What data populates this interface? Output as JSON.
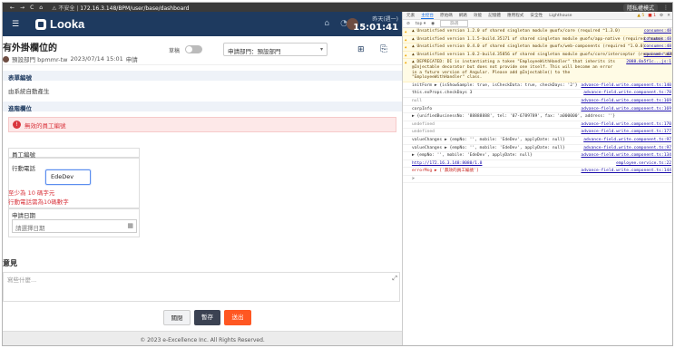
{
  "browser": {
    "nav": [
      "←",
      "→",
      "C",
      "⌂"
    ],
    "insecure_label": "⚠ 不安全",
    "address": "172.16.3.148/BPM/user/base/dashboard",
    "pill": "隱私權模式",
    "menu": "⋮"
  },
  "app": {
    "logo_text": "Looka",
    "date": "昨天(週一)",
    "time": "15:01:41",
    "form_title": "有外掛欄位的",
    "applicant": "預設部門 bpmmr-tw",
    "datetime": "2023/07/14 15:01",
    "status": "申請",
    "draft_label": "草稿",
    "dept_select": "申請部門：預設部門",
    "section_form": "表單編號",
    "auto_number": "由系統自動產生",
    "section_plugin": "進階欄位",
    "alert_text": "無效的員工編號",
    "fields": {
      "employee_id_label": "員工編號",
      "mobile_label": "行動電話",
      "mobile_value": "EdeDev",
      "err_min": "至少為 10 碼字元",
      "err_digits": "行動電話需為10碼數字",
      "apply_date_label": "申請日期",
      "apply_date_placeholder": "請選擇日期"
    },
    "opinion_label": "意見",
    "comment_placeholder": "寫些什麼...",
    "buttons": {
      "close": "關閉",
      "save": "暫存",
      "submit": "送出"
    },
    "footer": "© 2023 e-Excellence Inc. All Rights Reserved."
  },
  "devtools": {
    "tabs": [
      "元素",
      "主控台",
      "原始碼",
      "網路",
      "效能",
      "記憶體",
      "應用程式",
      "安全性",
      "Lighthouse"
    ],
    "active_tab": "主控台",
    "badge_warn": "▲ 5",
    "badge_err": "■ 1",
    "toolbar": {
      "context": "top ▾",
      "filter": "篩選"
    },
    "rows": [
      {
        "kind": "warn",
        "text": "▲ Unsatisfied version 1.2.0 of shared singleton module @uofx/core (required ^1.3.0)",
        "src": "consumes:48"
      },
      {
        "kind": "warn",
        "text": "▲ Unsatisfied version 1.1.5-build.35171 of shared singleton module @uofx/app-native (required ^auto)",
        "src": "consumes:48"
      },
      {
        "kind": "warn",
        "text": "▲ Unsatisfied version 0.4.0 of shared singleton module @uofx/web-components (required ^1.0.0)",
        "src": "consumes:48"
      },
      {
        "kind": "warn",
        "text": "▲ Unsatisfied version 1.0.2-build.35856 of shared singleton module @uofx/core/interceptor (required ^auto)",
        "src": "consumes:48"
      },
      {
        "kind": "warn",
        "text": "▲ DEPRECATED: DI is instantiating a token \"EmployeeWithHandler\" that inherits its @Injectable decorator but does not provide one itself. This will become an error in a future version of Angular. Please add @Injectable() to the \"EmployeeWithHandler\" class.",
        "src": "2088.0a5f1c...js:1"
      },
      {
        "kind": "normal",
        "text": "initForm ▶ {isShowSample: true, isCheckData: true, checkDays: '2'}",
        "src": "advance-field.write.component.ts:140"
      },
      {
        "kind": "normal",
        "text": "this.exProps.checkDays 3",
        "src": "advance-field.write.component.ts:78"
      },
      {
        "kind": "muted",
        "text": "null",
        "src": "advance-field.write.component.ts:169"
      },
      {
        "kind": "normal",
        "text": "corpInfo",
        "src": "advance-field.write.component.ts:169"
      },
      {
        "kind": "normal",
        "text": "▶ {unifiedBusinessNo: '88888888', tel: '07-6789789', fax: 'a000000', address: ''}",
        "src": ""
      },
      {
        "kind": "muted",
        "text": "undefined",
        "src": "advance-field.write.component.ts:170"
      },
      {
        "kind": "muted",
        "text": "undefined",
        "src": "advance-field.write.component.ts:177"
      },
      {
        "kind": "normal",
        "text": "valueChanges ▶ {empNo: '', mobile: 'EdeDev', applyDate: null}",
        "src": "advance-field.write.component.ts:97"
      },
      {
        "kind": "normal",
        "text": "valueChanges ▶ {empNo: '', mobile: 'EdeDev', applyDate: null}",
        "src": "advance-field.write.component.ts:97"
      },
      {
        "kind": "normal",
        "text": "  ▶ {empNo: '', mobile: 'EdeDev', applyDate: null}",
        "src": "advance-field.write.component.ts:134"
      },
      {
        "kind": "link",
        "text": "http://172.16.3.148:8080/1.0",
        "src": "employee.service.ts:22"
      },
      {
        "kind": "red",
        "text": "errorMsg ▶ ['無效的員工編號']",
        "src": "advance-field.write.component.ts:144"
      },
      {
        "kind": "normal",
        "text": ">",
        "src": ""
      }
    ]
  }
}
